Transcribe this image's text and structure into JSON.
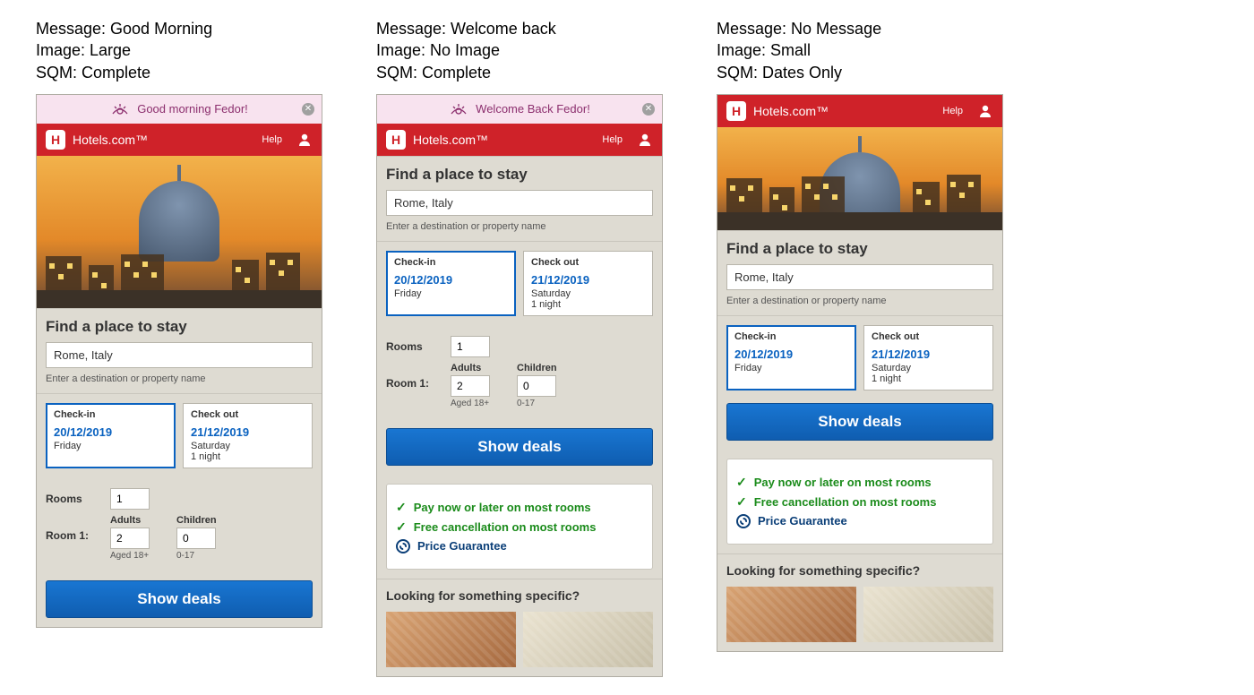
{
  "variants": [
    {
      "caption": {
        "message": "Message: Good Morning",
        "image": "Image: Large",
        "sqm": "SQM: Complete"
      },
      "config": {
        "greeting": "morning",
        "hero": "large",
        "searchModule": "complete",
        "showBadges": false,
        "showSpecific": false
      }
    },
    {
      "caption": {
        "message": "Message: Welcome back",
        "image": "Image: No Image",
        "sqm": "SQM: Complete"
      },
      "config": {
        "greeting": "welcome",
        "hero": "none",
        "searchModule": "complete",
        "showBadges": true,
        "showSpecific": true
      }
    },
    {
      "caption": {
        "message": "Message: No Message",
        "image": "Image: Small",
        "sqm": "SQM: Dates Only"
      },
      "config": {
        "greeting": "none",
        "hero": "small",
        "searchModule": "dates-only",
        "showBadges": true,
        "showSpecific": true
      }
    }
  ],
  "greetings": {
    "morning": "Good morning Fedor!",
    "welcome": "Welcome Back Fedor!"
  },
  "brand": {
    "logoLetter": "H",
    "name": "Hotels.com™",
    "help": "Help"
  },
  "search": {
    "title": "Find a place to stay",
    "destinationValue": "Rome, Italy",
    "destinationHint": "Enter a destination or property name",
    "checkinLabel": "Check-in",
    "checkinDate": "20/12/2019",
    "checkinDay": "Friday",
    "checkoutLabel": "Check out",
    "checkoutDate": "21/12/2019",
    "checkoutDay": "Saturday",
    "nightsText": "1 night",
    "roomsLabel": "Rooms",
    "roomsValue": "1",
    "roomPrefix": "Room 1:",
    "adultsLabel": "Adults",
    "adultsValue": "2",
    "adultsSub": "Aged 18+",
    "childrenLabel": "Children",
    "childrenValue": "0",
    "childrenSub": "0-17",
    "cta": "Show deals"
  },
  "badges": {
    "payNow": "Pay now or later on most rooms",
    "freeCancel": "Free cancellation on most rooms",
    "priceGuarantee": "Price Guarantee"
  },
  "specific": {
    "title": "Looking for something specific?"
  }
}
